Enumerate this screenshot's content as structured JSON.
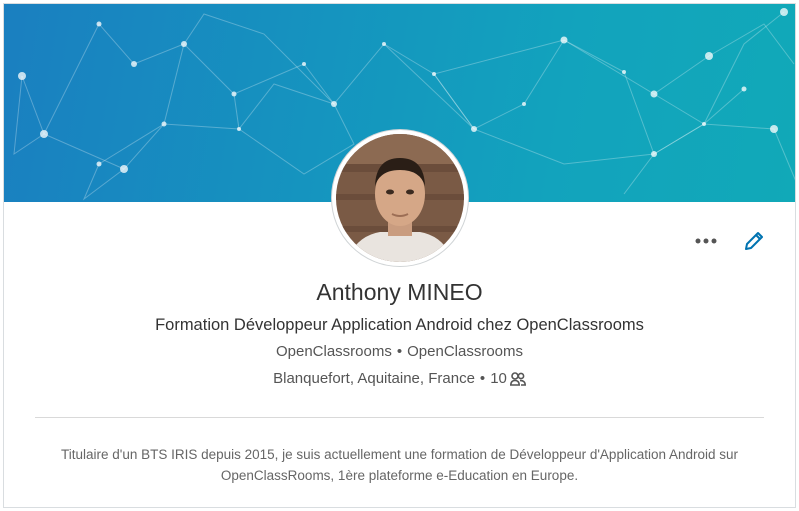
{
  "profile": {
    "name": "Anthony MINEO",
    "headline": "Formation Développeur Application Android chez OpenClassrooms",
    "current_company": "OpenClassrooms",
    "education": "OpenClassrooms",
    "separator": "•",
    "location": "Blanquefort, Aquitaine, France",
    "connections": "10",
    "summary": "Titulaire d'un BTS IRIS depuis 2015, je suis actuellement une formation de Développeur d'Application Android sur OpenClassRooms, 1ère plateforme e-Education en Europe."
  },
  "icons": {
    "more": "more-horizontal-icon",
    "edit": "pencil-icon",
    "connections": "people-icon"
  },
  "colors": {
    "banner_start": "#1a7fc0",
    "banner_end": "#11a9b8",
    "accent": "#0073b1"
  }
}
